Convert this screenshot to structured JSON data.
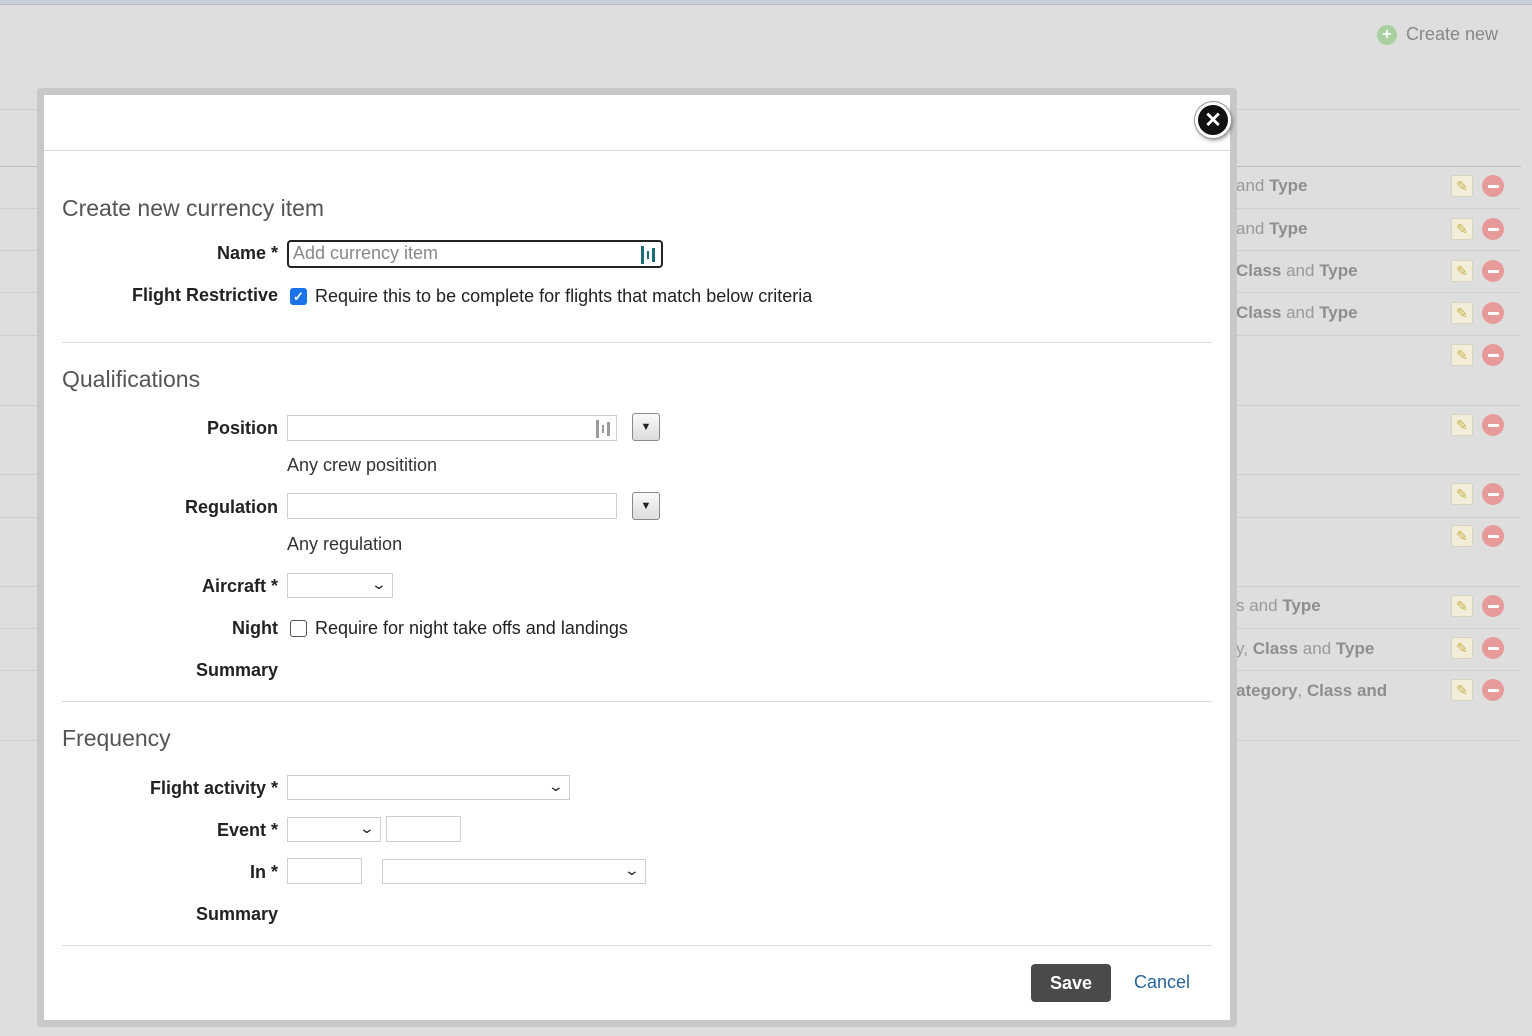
{
  "background": {
    "create_new_label": "Create new",
    "rows": [
      {
        "pre": "and ",
        "b1": "Type",
        "mid": "",
        "b2": ""
      },
      {
        "pre": "and ",
        "b1": "Type",
        "mid": "",
        "b2": ""
      },
      {
        "pre": "",
        "b1": "Class",
        "mid": " and ",
        "b2": "Type"
      },
      {
        "pre": "",
        "b1": "Class",
        "mid": " and ",
        "b2": "Type"
      },
      {
        "pre": "s and ",
        "b1": "Type",
        "mid": "",
        "b2": ""
      },
      {
        "pre": "y, ",
        "b1": "Class",
        "mid": " and ",
        "b2": "Type"
      },
      {
        "pre": "",
        "b1": "ategory",
        "mid": ", ",
        "b2": "Class and"
      }
    ]
  },
  "modal": {
    "close_symbol": "✕",
    "title": "Create new currency item",
    "name_label": "Name *",
    "name_placeholder": "Add currency item",
    "flight_restrictive_label": "Flight Restrictive",
    "flight_restrictive_checked": true,
    "flight_restrictive_text": "Require this to be complete for flights that match below criteria",
    "qualifications": {
      "title": "Qualifications",
      "position_label": "Position",
      "position_help": "Any crew positition",
      "regulation_label": "Regulation",
      "regulation_help": "Any regulation",
      "aircraft_label": "Aircraft *",
      "night_label": "Night",
      "night_checked": false,
      "night_text": "Require for night take offs and landings",
      "summary_label": "Summary"
    },
    "frequency": {
      "title": "Frequency",
      "flight_activity_label": "Flight activity *",
      "event_label": "Event *",
      "in_label": "In *",
      "summary_label": "Summary"
    },
    "save_label": "Save",
    "cancel_label": "Cancel"
  },
  "colors": {
    "accent_checkbox": "#1a73e8",
    "save_button": "#4a4a4a",
    "link": "#2a6496",
    "grip_teal": "#1d6c73"
  }
}
